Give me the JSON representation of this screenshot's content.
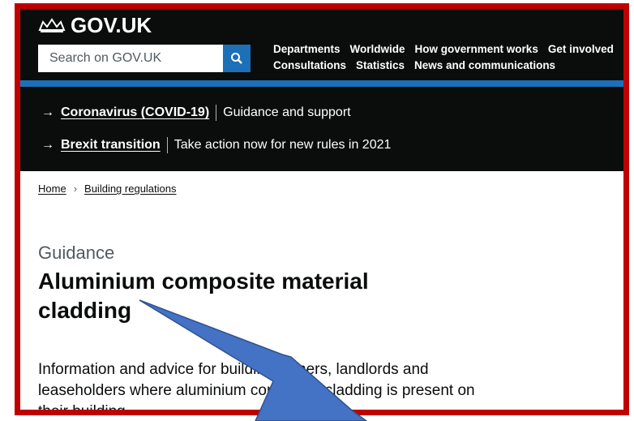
{
  "header": {
    "logo_text": "GOV.UK",
    "search_placeholder": "Search on GOV.UK",
    "nav_row1": [
      "Departments",
      "Worldwide",
      "How government works",
      "Get involved"
    ],
    "nav_row2": [
      "Consultations",
      "Statistics",
      "News and communications"
    ]
  },
  "banner": {
    "covid_link": "Coronavirus (COVID-19)",
    "covid_text": "Guidance and support",
    "brexit_link": "Brexit transition",
    "brexit_text": "Take action now for new rules in 2021"
  },
  "breadcrumb": [
    "Home",
    "Building regulations"
  ],
  "page": {
    "caption": "Guidance",
    "title": "Aluminium composite material cladding",
    "description": "Information and advice for building owners, landlords and leaseholders where aluminium composite cladding is present on their building."
  },
  "colors": {
    "frame": "#c00000",
    "header_bg": "#0b0c0c",
    "accent_blue": "#1d70b8",
    "pointer_arrow": "#4472c4"
  }
}
